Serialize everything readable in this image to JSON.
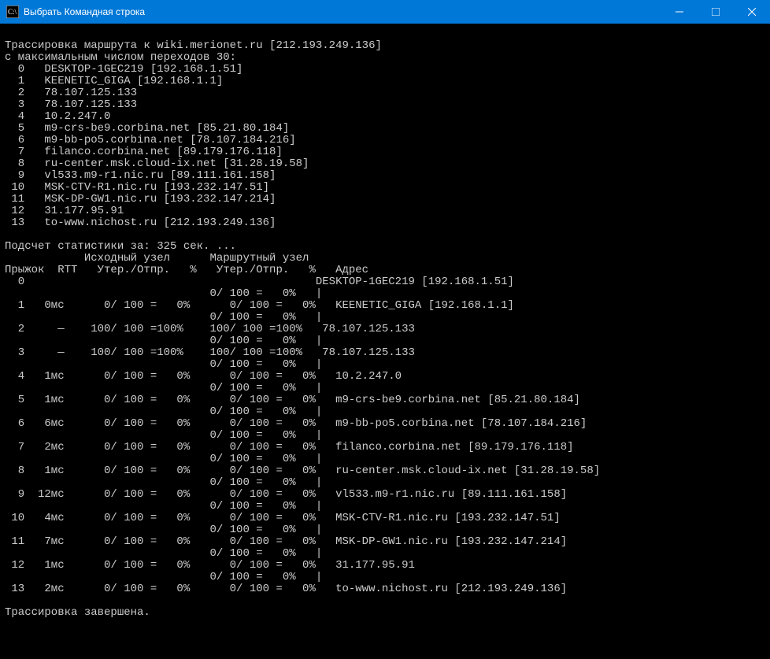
{
  "title": "Выбрать Командная строка",
  "trace": {
    "header_line": "Трассировка маршрута к wiki.merionet.ru [212.193.249.136]",
    "maxhops_line": "с максимальным числом переходов 30:",
    "hops": [
      {
        "n": "0",
        "text": "DESKTOP-1GEC219 [192.168.1.51]"
      },
      {
        "n": "1",
        "text": "KEENETIC_GIGA [192.168.1.1]"
      },
      {
        "n": "2",
        "text": "78.107.125.133"
      },
      {
        "n": "3",
        "text": "78.107.125.133"
      },
      {
        "n": "4",
        "text": "10.2.247.0"
      },
      {
        "n": "5",
        "text": "m9-crs-be9.corbina.net [85.21.80.184]"
      },
      {
        "n": "6",
        "text": "m9-bb-po5.corbina.net [78.107.184.216]"
      },
      {
        "n": "7",
        "text": "filanco.corbina.net [89.179.176.118]"
      },
      {
        "n": "8",
        "text": "ru-center.msk.cloud-ix.net [31.28.19.58]"
      },
      {
        "n": "9",
        "text": "vl533.m9-r1.nic.ru [89.111.161.158]"
      },
      {
        "n": "10",
        "text": "MSK-CTV-R1.nic.ru [193.232.147.51]"
      },
      {
        "n": "11",
        "text": "MSK-DP-GW1.nic.ru [193.232.147.214]"
      },
      {
        "n": "12",
        "text": "31.177.95.91"
      },
      {
        "n": "13",
        "text": "to-www.nichost.ru [212.193.249.136]"
      }
    ]
  },
  "stats": {
    "summary_line": "Подсчет статистики за: 325 сек. ...",
    "header1": "            Исходный узел      Маршрутный узел",
    "header2": "Прыжок  RTT   Утер./Отпр.   %   Утер./Отпр.   %   Адрес",
    "rows": [
      {
        "hop": "0",
        "rtt": "",
        "src": "",
        "dst": "",
        "addr": "DESKTOP-1GEC219 [192.168.1.51]",
        "link": "  0/ 100 =   0%"
      },
      {
        "hop": "1",
        "rtt": "0мс",
        "src": "   0/ 100 =   0%",
        "dst": "   0/ 100 =   0%",
        "addr": "KEENETIC_GIGA [192.168.1.1]",
        "link": "  0/ 100 =   0%"
      },
      {
        "hop": "2",
        "rtt": "—",
        "src": " 100/ 100 =100%",
        "dst": " 100/ 100 =100%",
        "addr": "78.107.125.133",
        "link": "  0/ 100 =   0%"
      },
      {
        "hop": "3",
        "rtt": "—",
        "src": " 100/ 100 =100%",
        "dst": " 100/ 100 =100%",
        "addr": "78.107.125.133",
        "link": "  0/ 100 =   0%"
      },
      {
        "hop": "4",
        "rtt": "1мс",
        "src": "   0/ 100 =   0%",
        "dst": "   0/ 100 =   0%",
        "addr": "10.2.247.0",
        "link": "  0/ 100 =   0%"
      },
      {
        "hop": "5",
        "rtt": "1мс",
        "src": "   0/ 100 =   0%",
        "dst": "   0/ 100 =   0%",
        "addr": "m9-crs-be9.corbina.net [85.21.80.184]",
        "link": "  0/ 100 =   0%"
      },
      {
        "hop": "6",
        "rtt": "6мс",
        "src": "   0/ 100 =   0%",
        "dst": "   0/ 100 =   0%",
        "addr": "m9-bb-po5.corbina.net [78.107.184.216]",
        "link": "  0/ 100 =   0%"
      },
      {
        "hop": "7",
        "rtt": "2мс",
        "src": "   0/ 100 =   0%",
        "dst": "   0/ 100 =   0%",
        "addr": "filanco.corbina.net [89.179.176.118]",
        "link": "  0/ 100 =   0%"
      },
      {
        "hop": "8",
        "rtt": "1мс",
        "src": "   0/ 100 =   0%",
        "dst": "   0/ 100 =   0%",
        "addr": "ru-center.msk.cloud-ix.net [31.28.19.58]",
        "link": "  0/ 100 =   0%"
      },
      {
        "hop": "9",
        "rtt": "12мс",
        "src": "   0/ 100 =   0%",
        "dst": "   0/ 100 =   0%",
        "addr": "vl533.m9-r1.nic.ru [89.111.161.158]",
        "link": "  0/ 100 =   0%"
      },
      {
        "hop": "10",
        "rtt": "4мс",
        "src": "   0/ 100 =   0%",
        "dst": "   0/ 100 =   0%",
        "addr": "MSK-CTV-R1.nic.ru [193.232.147.51]",
        "link": "  0/ 100 =   0%"
      },
      {
        "hop": "11",
        "rtt": "7мс",
        "src": "   0/ 100 =   0%",
        "dst": "   0/ 100 =   0%",
        "addr": "MSK-DP-GW1.nic.ru [193.232.147.214]",
        "link": "  0/ 100 =   0%"
      },
      {
        "hop": "12",
        "rtt": "1мс",
        "src": "   0/ 100 =   0%",
        "dst": "   0/ 100 =   0%",
        "addr": "31.177.95.91",
        "link": "  0/ 100 =   0%"
      },
      {
        "hop": "13",
        "rtt": "2мс",
        "src": "   0/ 100 =   0%",
        "dst": "   0/ 100 =   0%",
        "addr": "to-www.nichost.ru [212.193.249.136]",
        "link": ""
      }
    ]
  },
  "done_line": "Трассировка завершена."
}
